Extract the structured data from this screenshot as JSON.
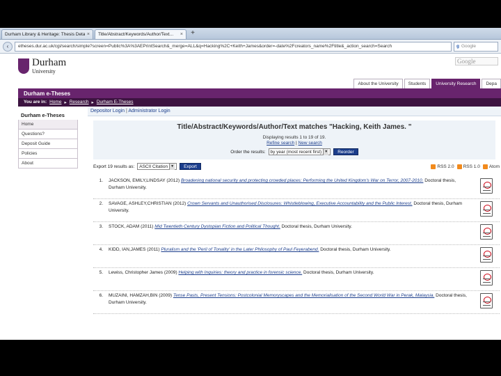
{
  "browser": {
    "tabs": [
      {
        "label": "Durham Library & Heritage: Thesis Details",
        "active": false
      },
      {
        "label": "Title/Abstract/Keywords/Author/Text...",
        "active": true
      }
    ],
    "new_tab": "+",
    "url": "etheses.dur.ac.uk/cgi/search/simple?screen=Public%3A%3AEPrintSearch&_merge=ALL&q=Hacking%2C+Keith+James&order=-date%2Fcreators_name%2Ftitle&_action_search=Search",
    "search_placeholder": "Google"
  },
  "site": {
    "logo_name": "Durham",
    "logo_sub": "University",
    "google_box": "Google",
    "top_tabs": [
      {
        "label": "About the University",
        "active": false
      },
      {
        "label": "Students",
        "active": false
      },
      {
        "label": "University Research",
        "active": true
      },
      {
        "label": "Depa",
        "active": false
      }
    ],
    "bar_title": "Durham e-Theses",
    "breadcrumb": {
      "prefix": "You are in:",
      "items": [
        "Home",
        "Research",
        "Durham E-Theses"
      ]
    }
  },
  "sidebar": {
    "title": "Durham e-Theses",
    "items": [
      "Home",
      "Questions?",
      "Deposit Guide",
      "Policies",
      "About"
    ]
  },
  "main": {
    "login": {
      "depositor": "Depositor Login",
      "sep": "|",
      "admin": "Administrator Login"
    },
    "title": "Title/Abstract/Keywords/Author/Text matches \"Hacking, Keith James. \"",
    "displaying": "Displaying results 1 to 19 of 19.",
    "refine": "Refine search",
    "links_sep": "|",
    "new_search": "New search",
    "order_label": "Order the results:",
    "order_value": "by year (most recent first)",
    "reorder": "Reorder",
    "export_label": "Export 19 results as:",
    "export_value": "ASCII Citation",
    "export_button": "Export",
    "feeds": [
      "RSS 2.0",
      "RSS 1.0",
      "Atom"
    ]
  },
  "results": [
    {
      "num": "1.",
      "pre": "JACKSON, EMILY,LINDSAY (2012)",
      "title": "Broadening national security and protecting crowded places: Performing the United Kingdom's War on Terror, 2007-2010.",
      "post": "Doctoral thesis, Durham University."
    },
    {
      "num": "2.",
      "pre": "SAVAGE, ASHLEY,CHRISTIAN (2012)",
      "title": "Crown Servants and Unauthorised Disclosures: Whistleblowing, Executive Accountability and the Public Interest.",
      "post": "Doctoral thesis, Durham University."
    },
    {
      "num": "3.",
      "pre": "STOCK, ADAM (2011)",
      "title": "Mid Twentieth Century Dystopian Fiction and Political Thought.",
      "post": "Doctoral thesis, Durham University."
    },
    {
      "num": "4.",
      "pre": "KIDD, IAN,JAMES (2011)",
      "title": "Pluralism and the 'Peril of Tonality' in the Later Philosophy of Paul Feyerabend.",
      "post": "Doctoral thesis, Durham University."
    },
    {
      "num": "5.",
      "pre": "Lewiss, Christopher James (2009)",
      "title": "Helping with Inquiries: theory and practice in forensic science.",
      "post": "Doctoral thesis, Durham University."
    },
    {
      "num": "6.",
      "pre": "MUZAINI, HAMZAH,BIN (2009)",
      "title": "Tense Pasts, Present Tensions: Postcolonial Memoryscapes and the Memorialisation of the Second World War in Perak, Malaysia.",
      "post": "Doctoral thesis, Durham University."
    }
  ]
}
